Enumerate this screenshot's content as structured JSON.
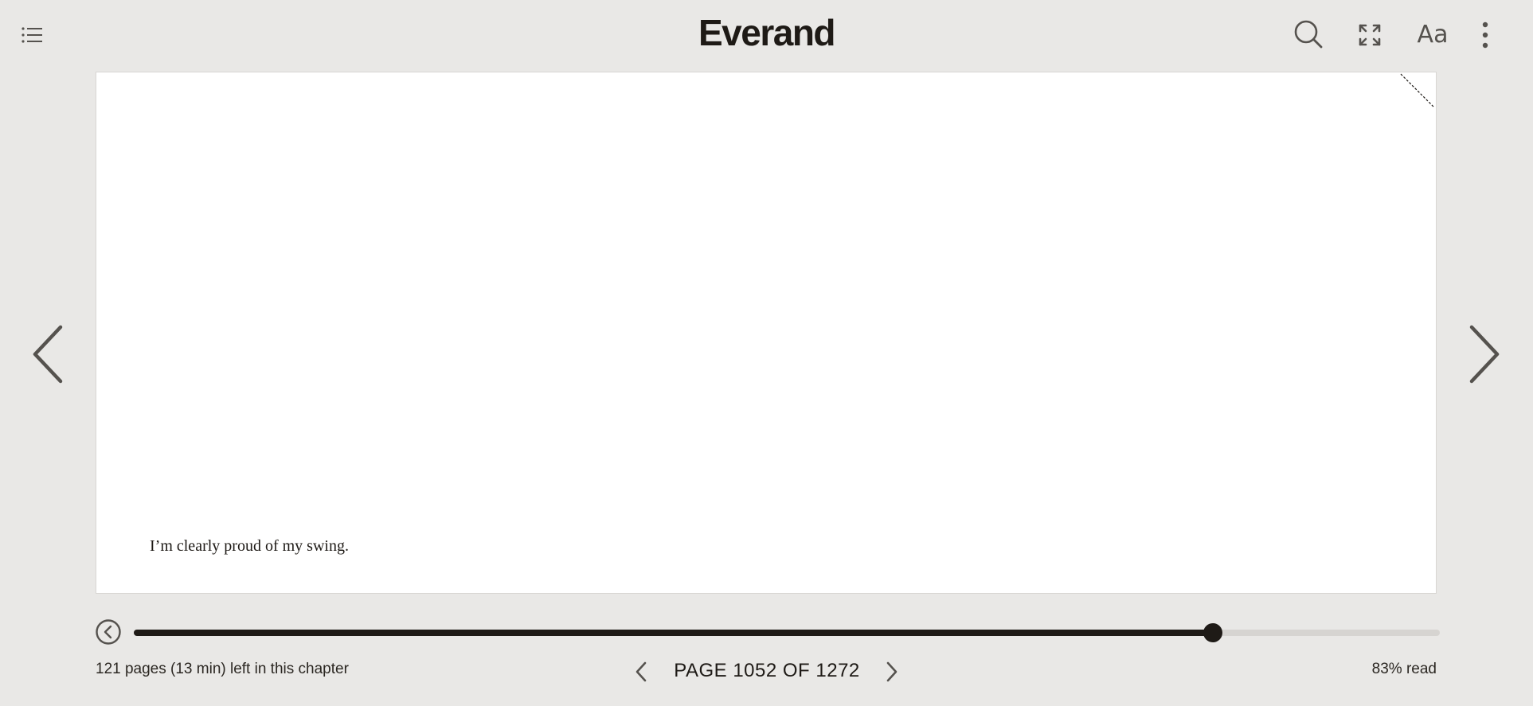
{
  "header": {
    "logo_text": "Everand",
    "icons": {
      "toc": "list-icon",
      "search": "search-icon",
      "fullscreen": "expand-icon",
      "font_settings_label": "Aa",
      "more": "more-vertical-icon"
    }
  },
  "page": {
    "text": "I’m clearly proud of my swing."
  },
  "navigation": {
    "prev_icon": "chevron-left-icon",
    "next_icon": "chevron-right-icon"
  },
  "progress": {
    "back_icon": "back-circle-icon",
    "fraction": 0.8263
  },
  "footer": {
    "chapter_remaining": "121 pages (13 min) left in this chapter",
    "page_indicator": "PAGE 1052 OF 1272",
    "read_percent": "83% read"
  },
  "colors": {
    "background": "#e9e8e6",
    "ink": "#1e1a16",
    "icon": "#55524e",
    "track": "#d6d4d1"
  }
}
